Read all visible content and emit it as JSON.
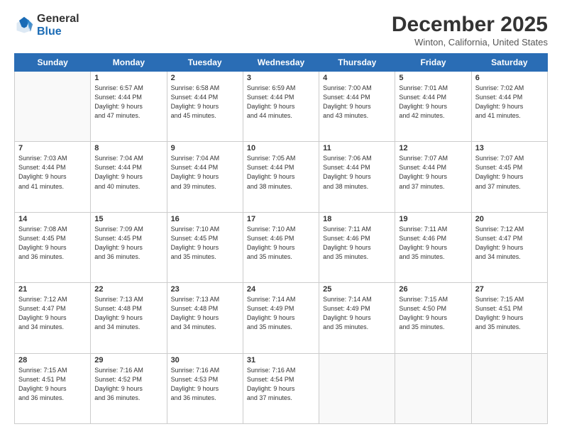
{
  "logo": {
    "line1": "General",
    "line2": "Blue"
  },
  "title": "December 2025",
  "location": "Winton, California, United States",
  "days_of_week": [
    "Sunday",
    "Monday",
    "Tuesday",
    "Wednesday",
    "Thursday",
    "Friday",
    "Saturday"
  ],
  "weeks": [
    [
      {
        "num": "",
        "info": ""
      },
      {
        "num": "1",
        "info": "Sunrise: 6:57 AM\nSunset: 4:44 PM\nDaylight: 9 hours\nand 47 minutes."
      },
      {
        "num": "2",
        "info": "Sunrise: 6:58 AM\nSunset: 4:44 PM\nDaylight: 9 hours\nand 45 minutes."
      },
      {
        "num": "3",
        "info": "Sunrise: 6:59 AM\nSunset: 4:44 PM\nDaylight: 9 hours\nand 44 minutes."
      },
      {
        "num": "4",
        "info": "Sunrise: 7:00 AM\nSunset: 4:44 PM\nDaylight: 9 hours\nand 43 minutes."
      },
      {
        "num": "5",
        "info": "Sunrise: 7:01 AM\nSunset: 4:44 PM\nDaylight: 9 hours\nand 42 minutes."
      },
      {
        "num": "6",
        "info": "Sunrise: 7:02 AM\nSunset: 4:44 PM\nDaylight: 9 hours\nand 41 minutes."
      }
    ],
    [
      {
        "num": "7",
        "info": "Sunrise: 7:03 AM\nSunset: 4:44 PM\nDaylight: 9 hours\nand 41 minutes."
      },
      {
        "num": "8",
        "info": "Sunrise: 7:04 AM\nSunset: 4:44 PM\nDaylight: 9 hours\nand 40 minutes."
      },
      {
        "num": "9",
        "info": "Sunrise: 7:04 AM\nSunset: 4:44 PM\nDaylight: 9 hours\nand 39 minutes."
      },
      {
        "num": "10",
        "info": "Sunrise: 7:05 AM\nSunset: 4:44 PM\nDaylight: 9 hours\nand 38 minutes."
      },
      {
        "num": "11",
        "info": "Sunrise: 7:06 AM\nSunset: 4:44 PM\nDaylight: 9 hours\nand 38 minutes."
      },
      {
        "num": "12",
        "info": "Sunrise: 7:07 AM\nSunset: 4:44 PM\nDaylight: 9 hours\nand 37 minutes."
      },
      {
        "num": "13",
        "info": "Sunrise: 7:07 AM\nSunset: 4:45 PM\nDaylight: 9 hours\nand 37 minutes."
      }
    ],
    [
      {
        "num": "14",
        "info": "Sunrise: 7:08 AM\nSunset: 4:45 PM\nDaylight: 9 hours\nand 36 minutes."
      },
      {
        "num": "15",
        "info": "Sunrise: 7:09 AM\nSunset: 4:45 PM\nDaylight: 9 hours\nand 36 minutes."
      },
      {
        "num": "16",
        "info": "Sunrise: 7:10 AM\nSunset: 4:45 PM\nDaylight: 9 hours\nand 35 minutes."
      },
      {
        "num": "17",
        "info": "Sunrise: 7:10 AM\nSunset: 4:46 PM\nDaylight: 9 hours\nand 35 minutes."
      },
      {
        "num": "18",
        "info": "Sunrise: 7:11 AM\nSunset: 4:46 PM\nDaylight: 9 hours\nand 35 minutes."
      },
      {
        "num": "19",
        "info": "Sunrise: 7:11 AM\nSunset: 4:46 PM\nDaylight: 9 hours\nand 35 minutes."
      },
      {
        "num": "20",
        "info": "Sunrise: 7:12 AM\nSunset: 4:47 PM\nDaylight: 9 hours\nand 34 minutes."
      }
    ],
    [
      {
        "num": "21",
        "info": "Sunrise: 7:12 AM\nSunset: 4:47 PM\nDaylight: 9 hours\nand 34 minutes."
      },
      {
        "num": "22",
        "info": "Sunrise: 7:13 AM\nSunset: 4:48 PM\nDaylight: 9 hours\nand 34 minutes."
      },
      {
        "num": "23",
        "info": "Sunrise: 7:13 AM\nSunset: 4:48 PM\nDaylight: 9 hours\nand 34 minutes."
      },
      {
        "num": "24",
        "info": "Sunrise: 7:14 AM\nSunset: 4:49 PM\nDaylight: 9 hours\nand 35 minutes."
      },
      {
        "num": "25",
        "info": "Sunrise: 7:14 AM\nSunset: 4:49 PM\nDaylight: 9 hours\nand 35 minutes."
      },
      {
        "num": "26",
        "info": "Sunrise: 7:15 AM\nSunset: 4:50 PM\nDaylight: 9 hours\nand 35 minutes."
      },
      {
        "num": "27",
        "info": "Sunrise: 7:15 AM\nSunset: 4:51 PM\nDaylight: 9 hours\nand 35 minutes."
      }
    ],
    [
      {
        "num": "28",
        "info": "Sunrise: 7:15 AM\nSunset: 4:51 PM\nDaylight: 9 hours\nand 36 minutes."
      },
      {
        "num": "29",
        "info": "Sunrise: 7:16 AM\nSunset: 4:52 PM\nDaylight: 9 hours\nand 36 minutes."
      },
      {
        "num": "30",
        "info": "Sunrise: 7:16 AM\nSunset: 4:53 PM\nDaylight: 9 hours\nand 36 minutes."
      },
      {
        "num": "31",
        "info": "Sunrise: 7:16 AM\nSunset: 4:54 PM\nDaylight: 9 hours\nand 37 minutes."
      },
      {
        "num": "",
        "info": ""
      },
      {
        "num": "",
        "info": ""
      },
      {
        "num": "",
        "info": ""
      }
    ]
  ]
}
